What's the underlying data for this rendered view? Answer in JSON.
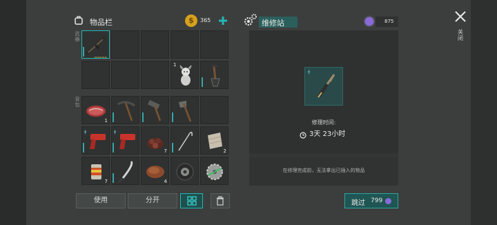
{
  "inventory": {
    "title": "物品栏",
    "coins": "365",
    "add_icon": "plus-icon"
  },
  "weapons_label": "武器",
  "backpack_label": "背包",
  "workshop": {
    "title": "维修站",
    "gems": "875",
    "repair_time_label": "修理时间:",
    "repair_time_value": "3天 23小时",
    "notice": "在修理完成前，无法拿出已插入的物品"
  },
  "buttons": {
    "use": "使用",
    "split": "分开",
    "skip": "跳过",
    "skip_cost": "799"
  },
  "close": {
    "label": "关闭"
  },
  "slots": {
    "weapon_dog_qty": "1",
    "steak_qty": "1",
    "bomb_qty": "7",
    "cloth_qty": "2",
    "can_qty": "7",
    "meat_qty": "4"
  },
  "colors": {
    "accent": "#26b6b6",
    "coin": "#d6a11d",
    "gem": "#8a6ad8",
    "bg": "#3b3e3d"
  }
}
